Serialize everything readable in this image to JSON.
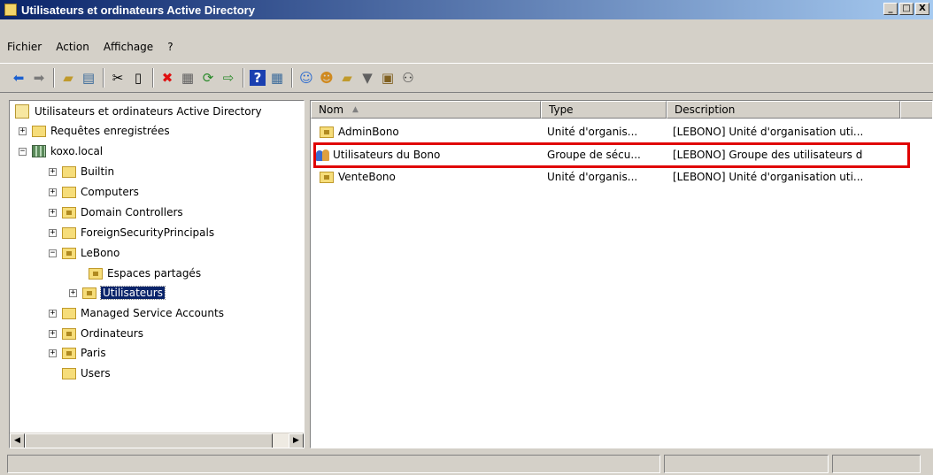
{
  "window": {
    "title": "Utilisateurs et ordinateurs Active Directory",
    "buttons": {
      "minimize": "_",
      "maximize": "□",
      "close": "X"
    }
  },
  "menu": {
    "items": [
      {
        "label": "Fichier"
      },
      {
        "label": "Action"
      },
      {
        "label": "Affichage"
      },
      {
        "label": "?"
      }
    ]
  },
  "toolbar": {
    "icons": [
      "back-icon",
      "forward-icon",
      "up-folder-icon",
      "show-tree-icon",
      "cut-icon",
      "copy-icon",
      "delete-icon",
      "properties-icon",
      "refresh-icon",
      "export-icon",
      "help-icon",
      "view-icon",
      "new-user-icon",
      "new-group-icon",
      "new-ou-icon",
      "filter-icon",
      "find-icon",
      "add-to-group-icon"
    ]
  },
  "tree": {
    "root": "Utilisateurs et ordinateurs Active Directory",
    "items": [
      {
        "label": "Requêtes enregistrées",
        "expander": "+"
      },
      {
        "label": "koxo.local",
        "expander": "−"
      },
      {
        "label": "Builtin",
        "expander": "+"
      },
      {
        "label": "Computers",
        "expander": "+"
      },
      {
        "label": "Domain Controllers",
        "expander": "+"
      },
      {
        "label": "ForeignSecurityPrincipals",
        "expander": "+"
      },
      {
        "label": "LeBono",
        "expander": "−"
      },
      {
        "label": "Espaces partagés",
        "expander": ""
      },
      {
        "label": "Utilisateurs",
        "expander": "+"
      },
      {
        "label": "Managed Service Accounts",
        "expander": "+"
      },
      {
        "label": "Ordinateurs",
        "expander": "+"
      },
      {
        "label": "Paris",
        "expander": "+"
      },
      {
        "label": "Users",
        "expander": ""
      }
    ]
  },
  "list": {
    "columns": {
      "name": "Nom",
      "type": "Type",
      "description": "Description"
    },
    "rows": [
      {
        "name": "AdminBono",
        "type": "Unité d'organis...",
        "description": "[LEBONO] Unité d'organisation uti..."
      },
      {
        "name": "Utilisateurs du Bono",
        "type": "Groupe de sécu...",
        "description": "[LEBONO] Groupe des utilisateurs d"
      },
      {
        "name": "VenteBono",
        "type": "Unité d'organis...",
        "description": "[LEBONO] Unité d'organisation uti..."
      }
    ]
  },
  "colors": {
    "highlight": "#e00000",
    "selection": "#0a246a",
    "titlebar": "#0a246a"
  }
}
